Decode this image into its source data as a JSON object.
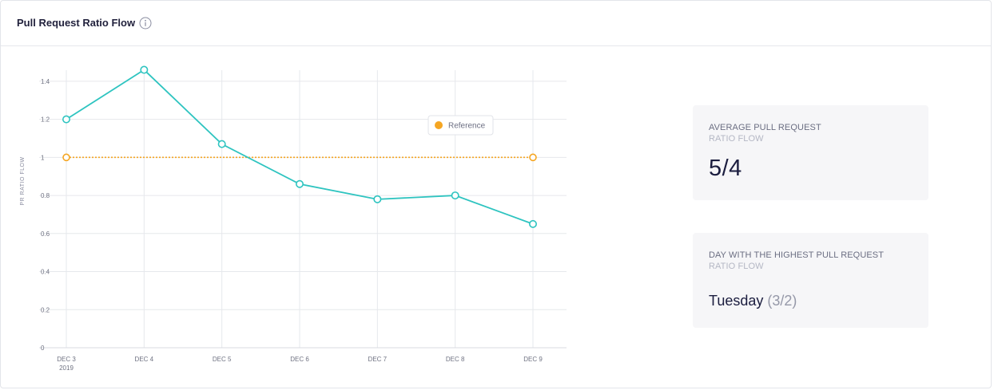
{
  "card": {
    "title": "Pull Request Ratio Flow",
    "info_icon": "info-circle-icon"
  },
  "stats": {
    "average": {
      "label": "AVERAGE PULL REQUEST",
      "sublabel": "RATIO FLOW",
      "value": "5/4"
    },
    "highest_day": {
      "label": "DAY WITH THE HIGHEST PULL REQUEST",
      "sublabel": "RATIO FLOW",
      "day": "Tuesday",
      "ratio": "(3/2)"
    }
  },
  "colors": {
    "series": "#2ec4c0",
    "reference": "#f5a623",
    "grid": "#e6e8ec"
  },
  "chart_data": {
    "type": "line",
    "ylabel": "PR RATIO FLOW",
    "xlabel": "",
    "ylim": [
      0,
      1.5
    ],
    "y_ticks": [
      0,
      0.2,
      0.4,
      0.6,
      0.8,
      1,
      1.2,
      1.4
    ],
    "y_tick_labels": [
      "0",
      "0.2",
      "0.4",
      "0.6",
      "0.8",
      "1",
      "1.2",
      "1.4"
    ],
    "categories": [
      "DEC 3",
      "DEC 4",
      "DEC 5",
      "DEC 6",
      "DEC 7",
      "DEC 8",
      "DEC 9"
    ],
    "category_sublabels": [
      "2019",
      "",
      "",
      "",
      "",
      "",
      ""
    ],
    "grid": true,
    "legend_position": "top-right",
    "series": [
      {
        "values": [
          1.2,
          1.46,
          1.07,
          0.86,
          0.78,
          0.8,
          0.65
        ]
      }
    ],
    "reference": {
      "name": "Reference",
      "value": 1,
      "style": "dotted"
    }
  }
}
